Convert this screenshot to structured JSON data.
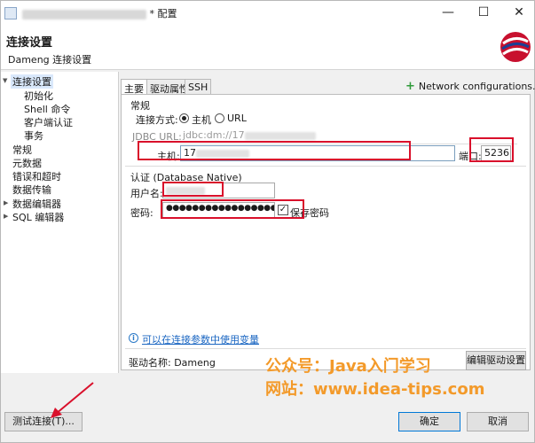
{
  "window": {
    "title_suffix": "* 配置",
    "controls": {
      "minimize": "—",
      "maximize": "☐",
      "close": "✕"
    }
  },
  "header": {
    "title": "连接设置",
    "subtitle": "Dameng 连接设置"
  },
  "nav": {
    "items": [
      {
        "label": "连接设置",
        "selected": true
      },
      {
        "label": "初始化"
      },
      {
        "label": "Shell 命令"
      },
      {
        "label": "客户端认证"
      },
      {
        "label": "事务"
      },
      {
        "label": "常规"
      },
      {
        "label": "元数据"
      },
      {
        "label": "错误和超时"
      },
      {
        "label": "数据传输"
      },
      {
        "label": "数据编辑器"
      },
      {
        "label": "SQL 编辑器"
      }
    ]
  },
  "tabs": [
    {
      "label": "主要",
      "active": true
    },
    {
      "label": "驱动属性"
    },
    {
      "label": "SSH"
    }
  ],
  "network_configurations": "Network configurations...",
  "general": {
    "section_title": "常规",
    "connect_method_label": "连接方式:",
    "radio_host": "主机",
    "radio_url": "URL",
    "jdbc_url_label": "JDBC URL:",
    "jdbc_url_value": "jdbc:dm://17",
    "host_label": "主机:",
    "host_value": "17",
    "port_label": "端口:",
    "port_value": "5236"
  },
  "auth": {
    "section_title": "认证 (Database Native)",
    "username_label": "用户名:",
    "password_label": "密码:",
    "password_value": "●●●●●●●●●●●●●●●●●",
    "save_password_label": "保存密码"
  },
  "info_link": "可以在连接参数中使用变量",
  "driver": {
    "name_label": "驱动名称: Dameng",
    "edit_button": "编辑驱动设置"
  },
  "watermark": {
    "line1": "公众号：Java入门学习",
    "line2": "网站：www.idea-tips.com"
  },
  "buttons": {
    "test": "测试连接(T)...",
    "ok": "确定",
    "cancel": "取消"
  },
  "colors": {
    "highlight": "#d9102b",
    "accent": "#1a66c2",
    "watermark": "#f39a2a",
    "selected_bg": "#d9e8fb"
  }
}
